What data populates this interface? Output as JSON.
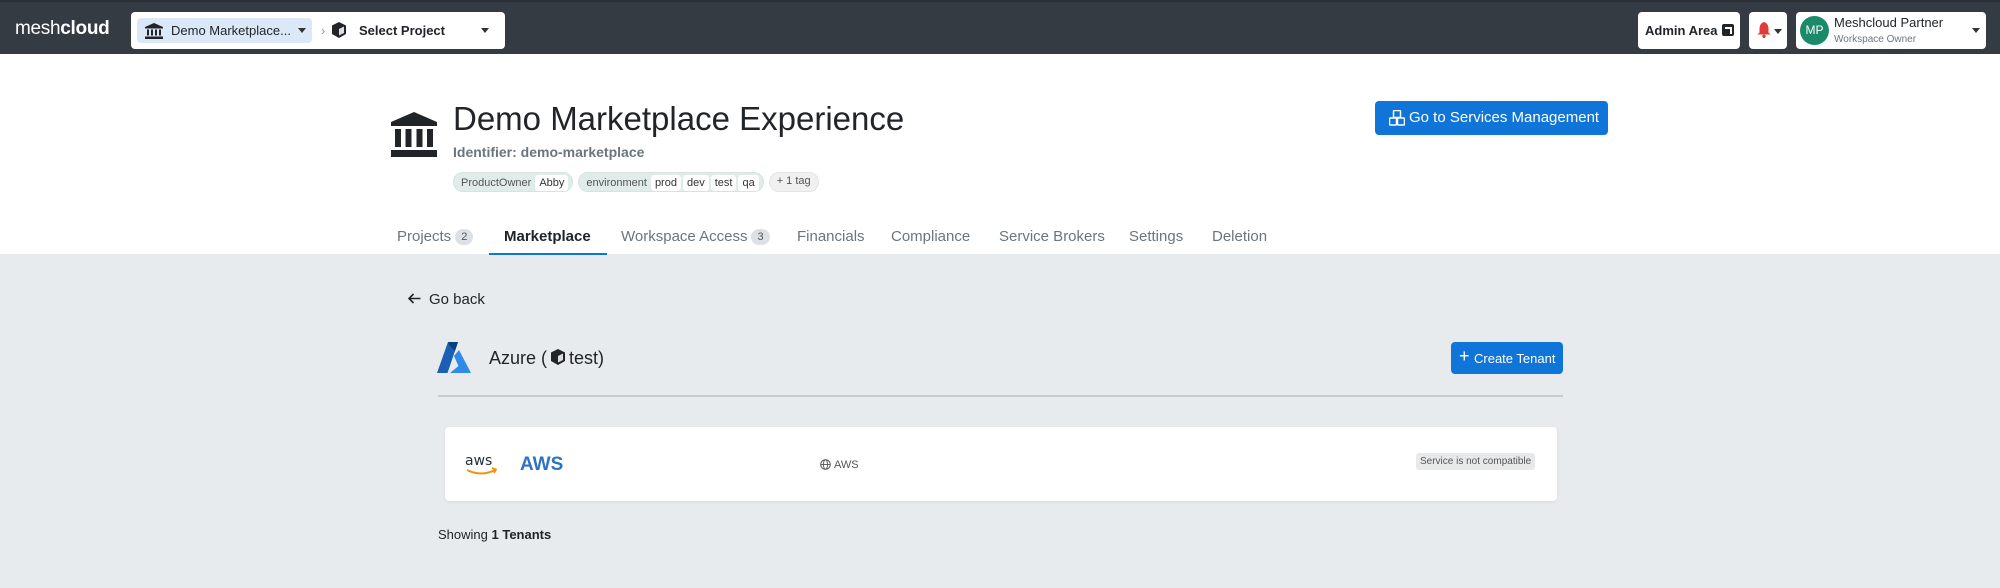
{
  "topbar": {
    "brand_light": "mesh",
    "brand_bold": "cloud",
    "workspace_selector": "Demo Marketplace...",
    "separator": "›",
    "project_selector": "Select Project",
    "admin_area": "Admin Area",
    "user": {
      "initials": "MP",
      "name": "Meshcloud Partner",
      "role": "Workspace Owner"
    }
  },
  "workspace": {
    "title": "Demo Marketplace Experience",
    "identifier": "Identifier: demo-marketplace",
    "tags": [
      {
        "key": "ProductOwner",
        "values": [
          "Abby"
        ]
      },
      {
        "key": "environment",
        "values": [
          "prod",
          "dev",
          "test",
          "qa"
        ]
      }
    ],
    "more_tags": "+ 1 tag",
    "services_button": "Go to Services Management"
  },
  "tabs": [
    {
      "label": "Projects",
      "badge": "2"
    },
    {
      "label": "Marketplace",
      "badge": ""
    },
    {
      "label": "Workspace Access",
      "badge": "3"
    },
    {
      "label": "Financials",
      "badge": ""
    },
    {
      "label": "Compliance",
      "badge": ""
    },
    {
      "label": "Service Brokers",
      "badge": ""
    },
    {
      "label": "Settings",
      "badge": ""
    },
    {
      "label": "Deletion",
      "badge": ""
    }
  ],
  "active_tab": "Marketplace",
  "main": {
    "back_label": "Go back",
    "platform_title_prefix": "Azure (",
    "platform_title_suffix": "test)",
    "create_tenant": "Create Tenant",
    "tenant": {
      "name": "AWS",
      "platform": "AWS",
      "status": "Service is not compatible"
    },
    "showing_prefix": "Showing",
    "showing_count": "1 Tenants"
  },
  "colors": {
    "topbar": "#353b42",
    "primary": "#1075d9",
    "link": "#2d73c4",
    "avatar": "#1a8a6a",
    "bell": "#e03b3b"
  },
  "icons": [
    "bank-icon",
    "cube-icon",
    "external-link-icon",
    "bell-icon",
    "cubes-icon",
    "arrow-left-icon",
    "azure-logo-icon",
    "plus-icon",
    "aws-logo-icon",
    "globe-icon"
  ]
}
